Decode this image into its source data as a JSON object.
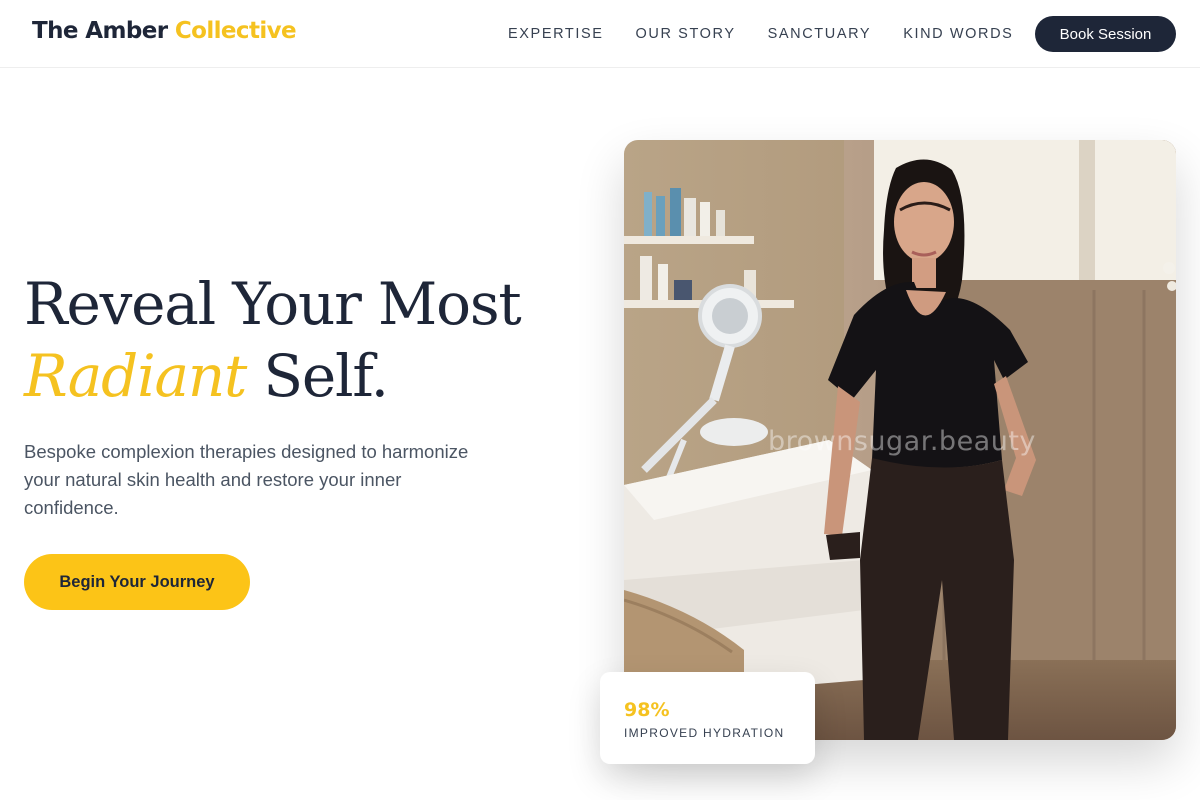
{
  "header": {
    "brand_part1": "The Amber",
    "brand_part2": "Collective",
    "nav": [
      "EXPERTISE",
      "OUR STORY",
      "SANCTUARY",
      "KIND WORDS"
    ],
    "book_label": "Book Session"
  },
  "hero": {
    "title_line1": "Reveal Your Most",
    "title_highlight": "Radiant",
    "title_end": "Self.",
    "description": "Bespoke complexion therapies designed to harmonize your natural skin health and restore your inner confidence.",
    "cta_label": "Begin Your Journey"
  },
  "photo": {
    "watermark": "brownsugar.beauty"
  },
  "stat": {
    "value": "98%",
    "label": "IMPROVED HYDRATION"
  },
  "colors": {
    "navy": "#1e2638",
    "amber": "#f5c220",
    "cta_yellow": "#fcc417",
    "text_gray": "#4b5563"
  },
  "icons": [
    "facial-magnifier-lamp"
  ]
}
